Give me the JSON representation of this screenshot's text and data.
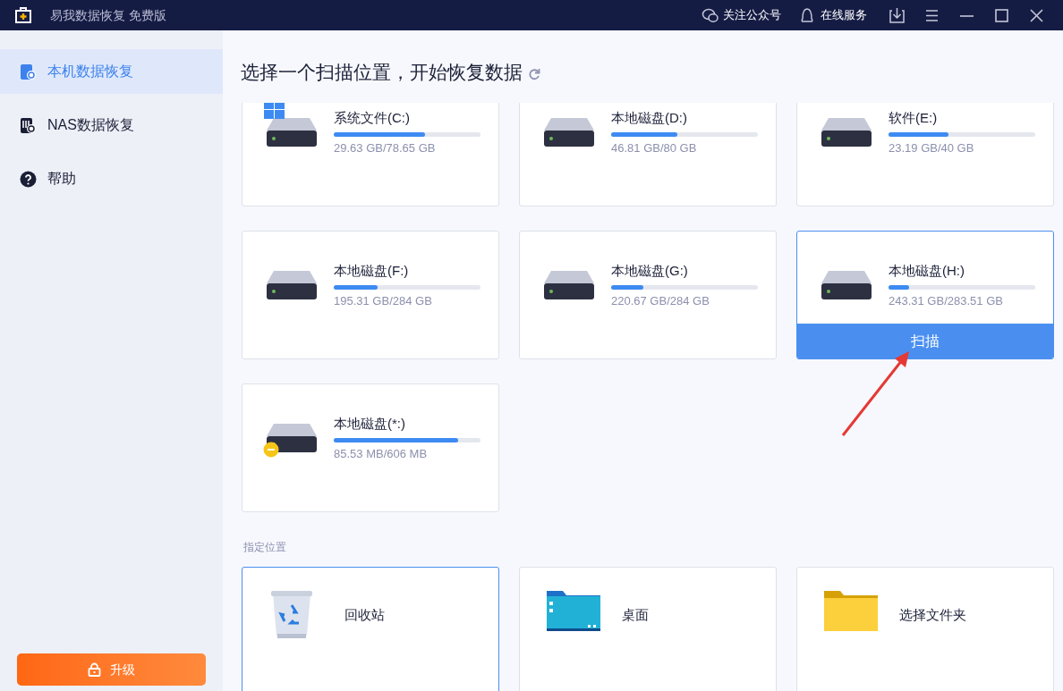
{
  "window": {
    "title": "易我数据恢复 免费版"
  },
  "header_links": [
    {
      "kind": "wechat",
      "label": "关注公众号"
    },
    {
      "kind": "support",
      "label": "在线服务"
    }
  ],
  "sidebar": {
    "items": [
      {
        "kind": "local",
        "label": "本机数据恢复",
        "selected": true
      },
      {
        "kind": "nas",
        "label": "NAS数据恢复",
        "selected": false
      },
      {
        "kind": "help",
        "label": "帮助",
        "selected": false
      }
    ],
    "upgrade": "升级"
  },
  "heading": "选择一个扫描位置，开始恢复数据",
  "scan_label": "扫描",
  "drives": [
    {
      "name": "系统文件(C:)",
      "size": "29.63 GB/78.65 GB",
      "level": 0.62,
      "kind": "system",
      "selected": false
    },
    {
      "name": "本地磁盘(D:)",
      "size": "46.81 GB/80 GB",
      "level": 0.45,
      "selected": false
    },
    {
      "name": "软件(E:)",
      "size": "23.19 GB/40 GB",
      "level": 0.41,
      "selected": false
    },
    {
      "name": "本地磁盘(F:)",
      "size": "195.31 GB/284 GB",
      "level": 0.3,
      "selected": false
    },
    {
      "name": "本地磁盘(G:)",
      "size": "220.67 GB/284 GB",
      "level": 0.22,
      "selected": false
    },
    {
      "name": "本地磁盘(H:)",
      "size": "243.31 GB/283.51 GB",
      "level": 0.14,
      "selected": true
    },
    {
      "name": "本地磁盘(*:)",
      "size": "85.53 MB/606 MB",
      "level": 0.85,
      "kind": "offline",
      "selected": false
    }
  ],
  "locations_label": "指定位置",
  "locations": [
    {
      "kind": "recycle",
      "label": "回收站",
      "selected": true
    },
    {
      "kind": "desktop",
      "label": "桌面",
      "selected": false
    },
    {
      "kind": "folder",
      "label": "选择文件夹",
      "selected": false
    }
  ]
}
